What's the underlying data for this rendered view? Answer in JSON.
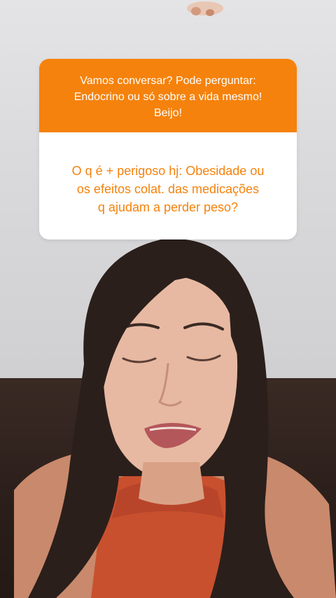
{
  "question_sticker": {
    "prompt_lines": [
      "Vamos conversar? Pode perguntar:",
      "Endocrino ou só sobre a vida mesmo!",
      "Beijo!"
    ],
    "answer_lines": [
      "O q é + perigoso hj: Obesidade ou",
      "os efeitos colat. das medicações",
      "q ajudam a perder peso?"
    ],
    "header_color": "#f5820c",
    "answer_text_color": "#f5820c"
  },
  "background": {
    "icon": "person-photo"
  }
}
